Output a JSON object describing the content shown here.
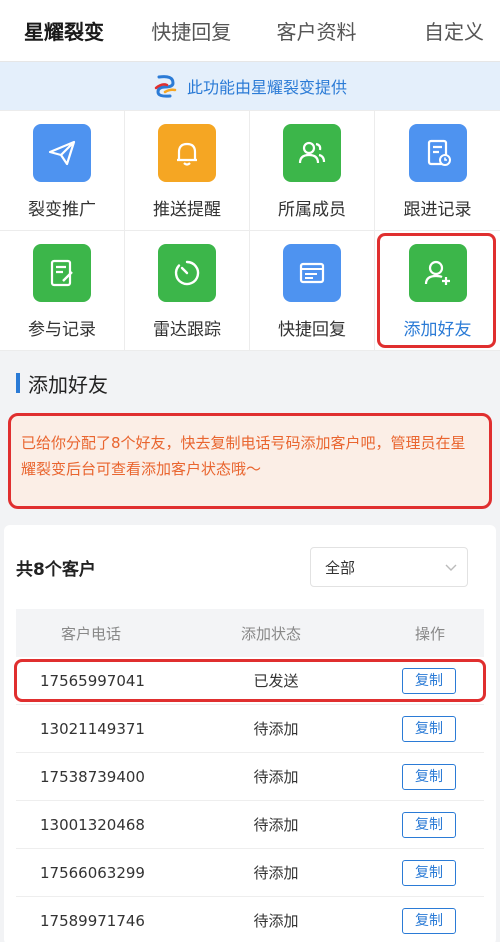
{
  "tabs": [
    "星耀裂变",
    "快捷回复",
    "客户资料",
    "自定义"
  ],
  "banner": {
    "text": "此功能由星耀裂变提供"
  },
  "grid": [
    {
      "label": "裂变推广",
      "icon": "send-icon",
      "color": "#4e93f0"
    },
    {
      "label": "推送提醒",
      "icon": "bell-icon",
      "color": "#f5a623"
    },
    {
      "label": "所属成员",
      "icon": "users-icon",
      "color": "#3cb64a"
    },
    {
      "label": "跟进记录",
      "icon": "record-icon",
      "color": "#4e93f0"
    },
    {
      "label": "参与记录",
      "icon": "edit-note-icon",
      "color": "#3cb64a"
    },
    {
      "label": "雷达跟踪",
      "icon": "radar-icon",
      "color": "#3cb64a"
    },
    {
      "label": "快捷回复",
      "icon": "message-icon",
      "color": "#4e93f0"
    },
    {
      "label": "添加好友",
      "icon": "add-user-icon",
      "color": "#3cb64a"
    }
  ],
  "section": {
    "title": "添加好友"
  },
  "notice": "已给你分配了8个好友，快去复制电话号码添加客户吧，管理员在星耀裂变后台可查看添加客户状态哦～",
  "list": {
    "count": "共8个客户",
    "filter": "全部",
    "headers": [
      "客户电话",
      "添加状态",
      "操作"
    ],
    "rows": [
      {
        "phone": "17565997041",
        "status": "已发送",
        "action": "复制"
      },
      {
        "phone": "13021149371",
        "status": "待添加",
        "action": "复制"
      },
      {
        "phone": "17538739400",
        "status": "待添加",
        "action": "复制"
      },
      {
        "phone": "13001320468",
        "status": "待添加",
        "action": "复制"
      },
      {
        "phone": "17566063299",
        "status": "待添加",
        "action": "复制"
      },
      {
        "phone": "17589971746",
        "status": "待添加",
        "action": "复制"
      }
    ]
  },
  "colors": {
    "accent": "#2b7bd6",
    "highlight": "#e02f2f",
    "notice_text": "#e9652f",
    "notice_bg": "#fbeee6"
  }
}
